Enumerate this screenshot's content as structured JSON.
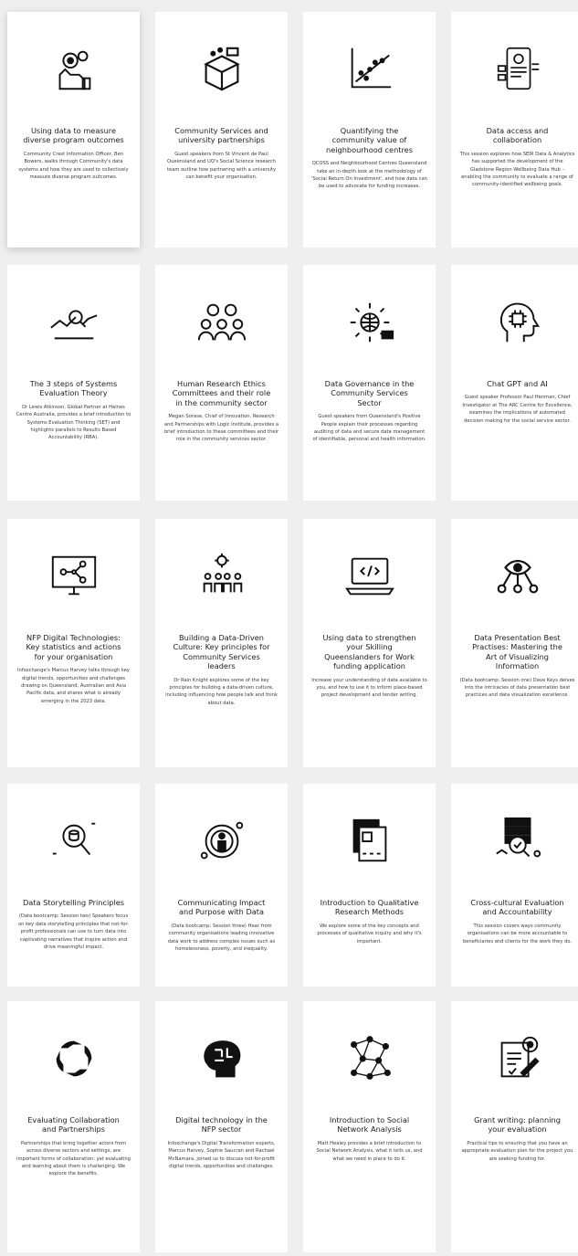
{
  "cards": [
    {
      "icon": "gear-hand-icon",
      "title": "Using data to measure diverse program outcomes",
      "desc": "Community Crest Information Officer, Ben Bowers, walks through Community's data systems and how they are used to collectively measure diverse program outcomes."
    },
    {
      "icon": "cube-network-icon",
      "title": "Community Services and university partnerships",
      "desc": "Guest speakers from St Vincent de Paul Queensland and UQ's Social Science research team outline how partnering with a university can benefit your organisation."
    },
    {
      "icon": "scatter-plot-icon",
      "title": "Quantifying the community value of neighbourhood centres",
      "desc": "QCOSS and Neighbourhood Centres Queensland take an in-depth look at the methodology of 'Social Return On Investment', and how data can be used to advocate for funding increases."
    },
    {
      "icon": "mobile-data-icon",
      "title": "Data access and collaboration",
      "desc": "This session explores how SEIR Data & Analytics has supported the development of the Gladstone Region Wellbeing Data Hub – enabling the community to evaluate a range of community-identified wellbeing goals."
    },
    {
      "icon": "trend-magnifier-icon",
      "title": "The 3 steps of Systems Evaluation Theory",
      "desc": "Dr Lewis Atkinson, Global Partner at Haines Centre Australia, provides a brief introduction to Systems Evaluation Thinking (SET) and highlights parallels to Results Based Accountability (RBA)."
    },
    {
      "icon": "team-group-icon",
      "title": "Human Research Ethics Committees and their role in the community sector",
      "desc": "Megan Sorase, Chief of Innovation, Research and Partnerships with Logic Institute, provides a brief introduction to these committees and their role in the community services sector."
    },
    {
      "icon": "data-governance-icon",
      "title": "Data Governance in the Community Services Sector",
      "desc": "Guest speakers from Queensland's Positive People explain their processes regarding auditing of data and secure data management of identifiable, personal and health information."
    },
    {
      "icon": "ai-head-icon",
      "title": "Chat GPT and AI",
      "desc": "Guest speaker Professor Paul Henman, Chief Investigator at The ARC Centre for Excellence, examines the implications of automated decision making for the social service sector."
    },
    {
      "icon": "monitor-network-icon",
      "title": "NFP Digital Technologies: Key statistics and actions for your organisation",
      "desc": "Infoxchange's Marcus Harvey talks through key digital trends, opportunities and challenges drawing on Queensland, Australian and Asia Pacific data, and shares what is already emerging in the 2023 data."
    },
    {
      "icon": "gear-people-icon",
      "title": "Building a Data-Driven Culture: Key principles for Community Services leaders",
      "desc": "Dr Rain Knight explores some of the key principles for building a data-driven culture, including influencing how people talk and think about data."
    },
    {
      "icon": "laptop-code-icon",
      "title": "Using data to strengthen your Skilling Queenslanders for Work funding application",
      "desc": "Increase your understanding of data available to you, and how to use it to inform place-based project development and tender writing."
    },
    {
      "icon": "eye-network-icon",
      "title": "Data Presentation Best Practises: Mastering the Art of Visualizing Information",
      "desc": "(Data bootcamp: Session one) Dave Keys delves into the intricacies of data presentation best practices and data visualization excellence."
    },
    {
      "icon": "database-search-icon",
      "title": "Data Storytelling Principles",
      "desc": "(Data bootcamp: Session two) Speakers focus on key data storytelling principles that not-for-profit professionals can use to turn data into captivating narratives that inspire action and drive meaningful impact."
    },
    {
      "icon": "person-target-icon",
      "title": "Communicating Impact and Purpose with Data",
      "desc": "(Data bootcamp: Session three) Hear from community organisations leading innovative data work to address complex issues such as homelessness, poverty, and inequality."
    },
    {
      "icon": "documents-question-icon",
      "title": "Introduction to Qualitative Research Methods",
      "desc": "We explore some of the key concepts and processes of qualitative inquiry and why it's important."
    },
    {
      "icon": "server-check-icon",
      "title": "Cross-cultural Evaluation and Accountability",
      "desc": "This session covers ways community organisations can be more accountable to beneficiaries and clients for the work they do."
    },
    {
      "icon": "hands-circle-icon",
      "title": "Evaluating Collaboration and Partnerships",
      "desc": "Partnerships that bring together actors from across diverse sectors and settings, are important forms of collaboration: yet evaluating and learning about them is challenging. We explore the benefits."
    },
    {
      "icon": "brain-circuit-icon",
      "title": "Digital technology in the NFP sector",
      "desc": "Infoxchange's Digital Transformation experts, Marcus Harvey, Sophie Saucran and Rachael McNamara, joined us to discuss not-for-profit digital trends, opportunities and challenges."
    },
    {
      "icon": "social-network-icon",
      "title": "Introduction to Social Network Analysis",
      "desc": "Matt Healey provides a brief introduction to Social Network Analysis, what it tells us, and what we need in place to do it."
    },
    {
      "icon": "grant-writing-icon",
      "title": "Grant writing: planning your evaluation",
      "desc": "Practical tips to ensuring that you have an appropriate evaluation plan for the project you are seeking funding for."
    }
  ]
}
